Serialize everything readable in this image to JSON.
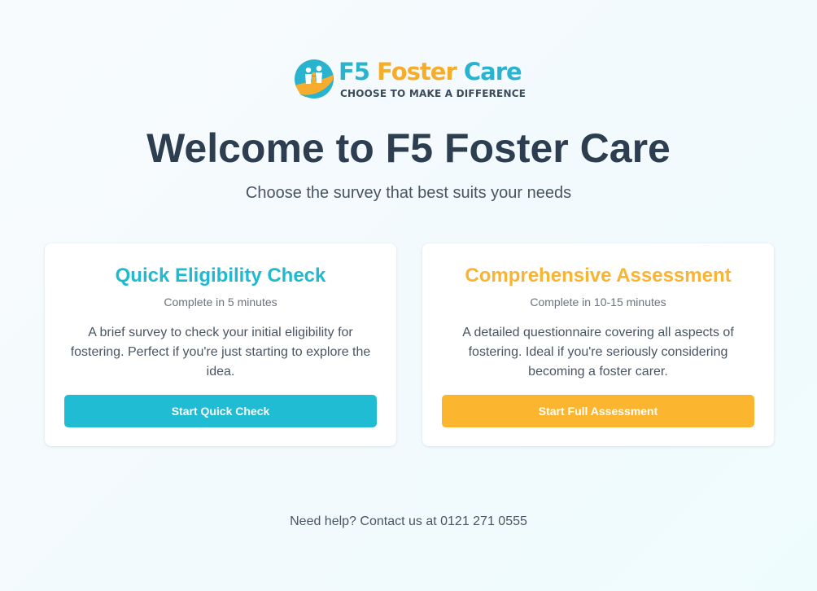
{
  "logo": {
    "name_part1": "F5",
    "name_part2": "Foster",
    "name_part3": "Care",
    "tagline": "CHOOSE TO MAKE A DIFFERENCE",
    "icon": "family-circle-icon"
  },
  "header": {
    "title": "Welcome to F5 Foster Care",
    "subtitle": "Choose the survey that best suits your needs"
  },
  "cards": [
    {
      "title": "Quick Eligibility Check",
      "duration": "Complete in 5 minutes",
      "description": "A brief survey to check your initial eligibility for fostering. Perfect if you're just starting to explore the idea.",
      "button_label": "Start Quick Check",
      "accent_color": "#1fbcd4"
    },
    {
      "title": "Comprehensive Assessment",
      "duration": "Complete in 10-15 minutes",
      "description": "A detailed questionnaire covering all aspects of fostering. Ideal if you're seriously considering becoming a foster carer.",
      "button_label": "Start Full Assessment",
      "accent_color": "#fbb52e"
    }
  ],
  "footer": {
    "help_text": "Need help? Contact us at 0121 271 0555"
  },
  "colors": {
    "brand_blue": "#2ab3cf",
    "brand_orange": "#f6ad2b",
    "heading": "#2c3e50",
    "body_text": "#4a5563"
  }
}
